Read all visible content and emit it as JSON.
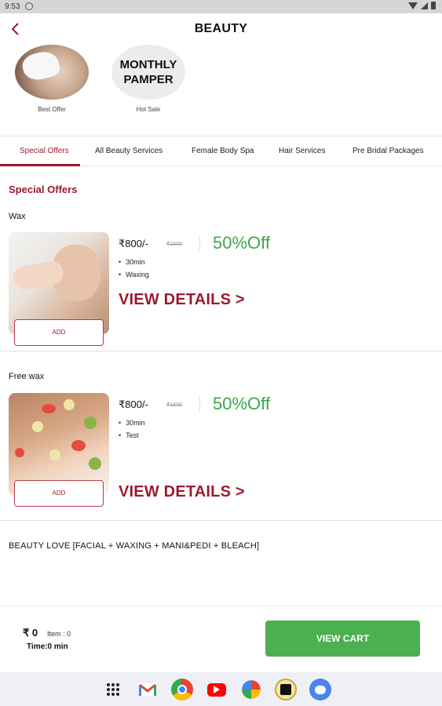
{
  "status": {
    "time": "9:53"
  },
  "header": {
    "title": "BEAUTY"
  },
  "banners": [
    {
      "caption": "Best Offer"
    },
    {
      "caption": "Hot Sale",
      "line1": "MONTHLY",
      "line2": "PAMPER"
    }
  ],
  "tabs": [
    "Special Offers",
    "All Beauty Services",
    "Female Body Spa",
    "Hair Services",
    "Pre Bridal Packages"
  ],
  "section": {
    "title": "Special Offers"
  },
  "items": [
    {
      "name": "Wax",
      "price": "₹800/-",
      "old_price": "₹1600",
      "discount": "50%Off",
      "bullets": [
        "30min",
        "Waxing"
      ],
      "add": "ADD",
      "view": "VIEW DETAILS >"
    },
    {
      "name": "Free wax",
      "price": "₹800/-",
      "old_price": "₹1600",
      "discount": "50%Off",
      "bullets": [
        "30min",
        "Test"
      ],
      "add": "ADD",
      "view": "VIEW DETAILS >"
    }
  ],
  "package": {
    "name": "BEAUTY LOVE [FACIAL + WAXING + MANI&PEDI + BLEACH]"
  },
  "cart": {
    "total": "₹ 0",
    "items": "Item : 0",
    "time": "Time:0 min",
    "button": "VIEW CART"
  },
  "colors": {
    "accent": "#9b1b30",
    "discount": "#39a84a",
    "cart_button": "#4caf50"
  },
  "dock": [
    "apps-grid-icon",
    "gmail-icon",
    "chrome-icon",
    "youtube-icon",
    "photos-icon",
    "keep-icon",
    "messages-icon"
  ]
}
